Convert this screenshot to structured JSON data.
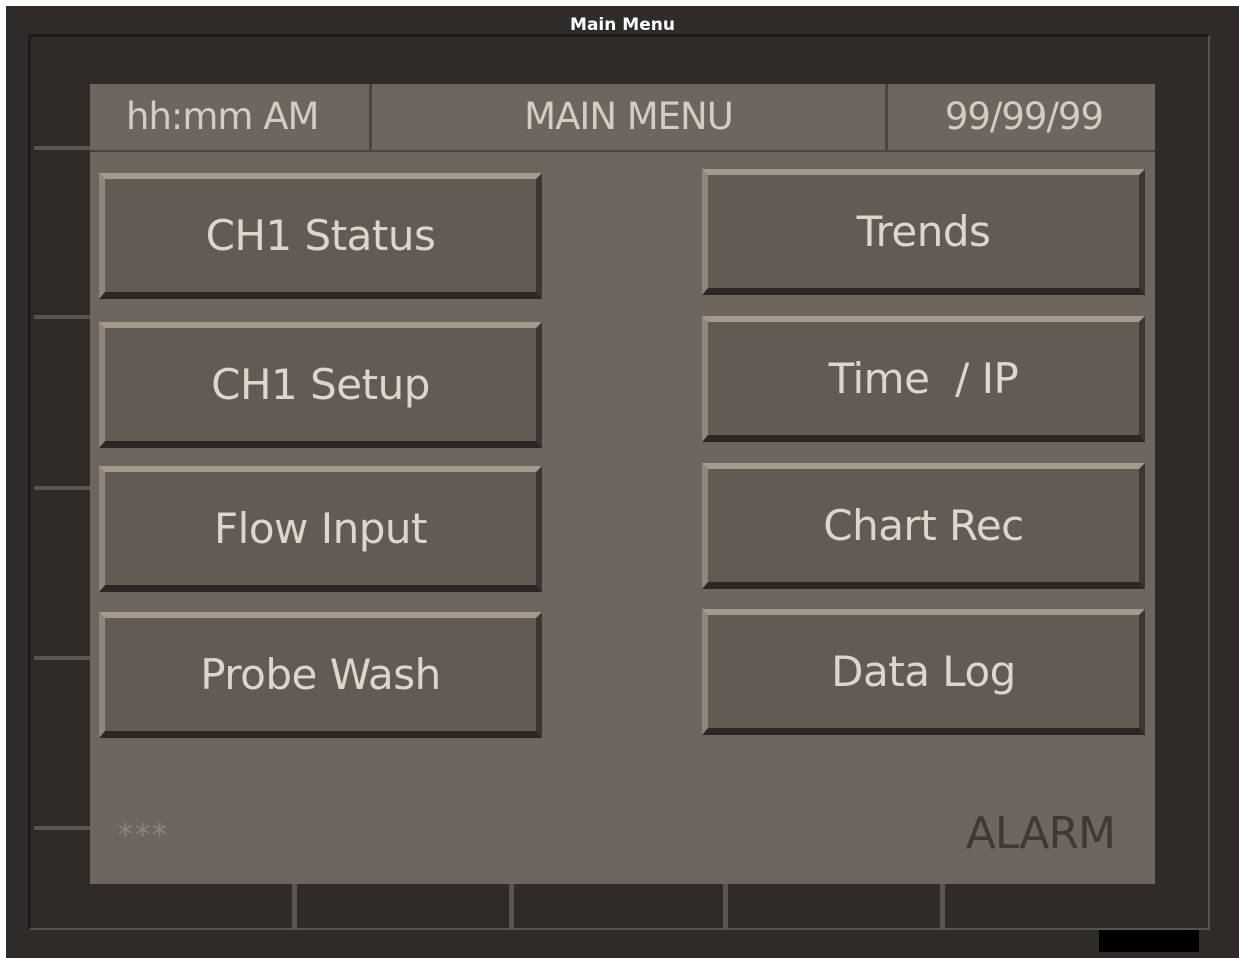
{
  "window": {
    "title": "Main Menu"
  },
  "header": {
    "time": "hh:mm AM",
    "title": "MAIN MENU",
    "date": "99/99/99"
  },
  "buttons": {
    "left": [
      {
        "label": "CH1 Status"
      },
      {
        "label": "CH1 Setup"
      },
      {
        "label": "Flow Input"
      },
      {
        "label": "Probe Wash"
      }
    ],
    "right": [
      {
        "label": "Trends"
      },
      {
        "label": "Time  / IP"
      },
      {
        "label": "Chart Rec"
      },
      {
        "label": "Data Log"
      }
    ]
  },
  "footer": {
    "status_stars": "***",
    "alarm_label": "ALARM"
  },
  "colors": {
    "frame": "#2e2b28",
    "panel": "#6e665e",
    "button_face": "#625b54",
    "button_text": "#dcd6cd",
    "alarm_text": "#3d3935"
  }
}
